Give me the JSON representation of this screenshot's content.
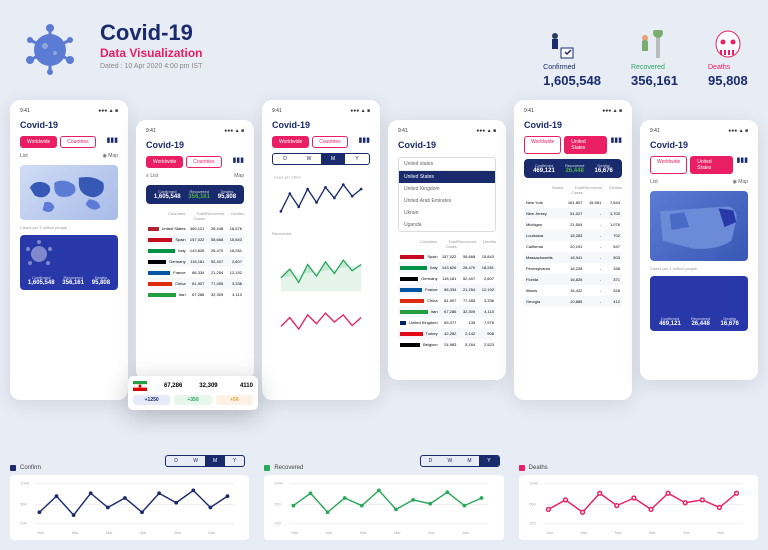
{
  "header": {
    "title": "Covid-19",
    "subtitle": "Data Visualization",
    "dated": "Dated : 10 Apr 2020 4:00 pm IST"
  },
  "top_stats": {
    "confirmed": {
      "label": "Confirmed",
      "value": "1,605,548",
      "color": "#1a2b6d"
    },
    "recovered": {
      "label": "Recovered",
      "value": "356,161",
      "color": "#2aa85c"
    },
    "deaths": {
      "label": "Deaths",
      "value": "95,808",
      "color": "#e91e63"
    }
  },
  "phone_common": {
    "time": "9:41",
    "title": "Covid-19",
    "tab_worldwide": "Worldwide",
    "tab_countries": "Countries",
    "tab_us": "United States",
    "list": "List",
    "map": "Map",
    "cases_per_million": "Cases per 1 million people"
  },
  "stat_bar": {
    "confirmed": {
      "label": "Confirmed",
      "value": "1,605,548"
    },
    "recovered": {
      "label": "Recovered",
      "value": "356,161"
    },
    "deaths": {
      "label": "Deaths",
      "value": "95,808"
    }
  },
  "us_stat_bar": {
    "confirmed": {
      "label": "Confirmed",
      "value": "469,121"
    },
    "recovered": {
      "label": "Recovered",
      "value": "26,448"
    },
    "deaths": {
      "label": "Deaths",
      "value": "16,676"
    }
  },
  "table_headers": {
    "country": "Countries",
    "total": "Total Cases",
    "recovered": "Recovered",
    "deaths": "Deaths"
  },
  "countries": [
    {
      "name": "United States",
      "flag": "#b22234",
      "total": "469,121",
      "recovered": "26,448",
      "deaths": "16,676"
    },
    {
      "name": "Spain",
      "flag": "#c60b1e",
      "total": "157,022",
      "recovered": "55,668",
      "deaths": "15,843"
    },
    {
      "name": "Italy",
      "flag": "#009246",
      "total": "143,626",
      "recovered": "28,470",
      "deaths": "18,281"
    },
    {
      "name": "Germany",
      "flag": "#000",
      "total": "118,181",
      "recovered": "52,407",
      "deaths": "2,607"
    },
    {
      "name": "France",
      "flag": "#0055a4",
      "total": "86,334",
      "recovered": "21,254",
      "deaths": "12,192"
    },
    {
      "name": "China",
      "flag": "#de2910",
      "total": "81,907",
      "recovered": "77,455",
      "deaths": "3,336"
    },
    {
      "name": "Iran",
      "flag": "#239f40",
      "total": "67,286",
      "recovered": "32,309",
      "deaths": "4,110"
    },
    {
      "name": "United Kingdom",
      "flag": "#012169",
      "total": "65,077",
      "recovered": "135",
      "deaths": "7,978"
    },
    {
      "name": "Turkey",
      "flag": "#e30a17",
      "total": "42,282",
      "recovered": "2,142",
      "deaths": "908"
    },
    {
      "name": "Belgium",
      "flag": "#000",
      "total": "24,983",
      "recovered": "5,164",
      "deaths": "2,523"
    }
  ],
  "us_states_header": {
    "state": "States",
    "total": "Total Cases",
    "recovered": "Recovered",
    "deaths": "Deaths"
  },
  "us_states": [
    {
      "name": "New York",
      "total": "161,807",
      "recovered": "15,561",
      "deaths": "7,844"
    },
    {
      "name": "New Jersey",
      "total": "51,027",
      "recovered": "-",
      "deaths": "1,700"
    },
    {
      "name": "Michigan",
      "total": "21,504",
      "recovered": "-",
      "deaths": "1,076"
    },
    {
      "name": "Louisiana",
      "total": "18,283",
      "recovered": "-",
      "deaths": "702"
    },
    {
      "name": "California",
      "total": "20,191",
      "recovered": "-",
      "deaths": "547"
    },
    {
      "name": "Massachusetts",
      "total": "18,941",
      "recovered": "-",
      "deaths": "503"
    },
    {
      "name": "Pennsylvania",
      "total": "18,228",
      "recovered": "-",
      "deaths": "338"
    },
    {
      "name": "Florida",
      "total": "16,826",
      "recovered": "-",
      "deaths": "371"
    },
    {
      "name": "Illinois",
      "total": "16,422",
      "recovered": "-",
      "deaths": "528"
    },
    {
      "name": "Georgia",
      "total": "10,885",
      "recovered": "-",
      "deaths": "412"
    }
  ],
  "dropdown": {
    "input": "United states",
    "selected": "United States",
    "items": [
      "United Kingdom",
      "United Arab Emirates",
      "Ukrain",
      "Uganda"
    ]
  },
  "popup": {
    "total": "67,286",
    "recovered": "32,309",
    "deaths": "4110",
    "delta_total": "+1250",
    "delta_recovered": "+350",
    "delta_deaths": "+56"
  },
  "time_tabs": [
    "D",
    "W",
    "M",
    "Y"
  ],
  "bottom": {
    "confirm": {
      "label": "Confirm",
      "color": "#1a2b6d"
    },
    "recovered": {
      "label": "Recovered",
      "color": "#2aa85c"
    },
    "deaths": {
      "label": "Deaths",
      "color": "#e91e63"
    },
    "y_ticks": [
      "1000",
      "500",
      "200"
    ],
    "x_ticks": [
      "Mar",
      "Mar",
      "Mar",
      "Mar",
      "Mar",
      "Mar",
      "Mar",
      "Mar",
      "Mar",
      "Mar",
      "Mar",
      "Mar"
    ],
    "y_axis": "Cases per million"
  },
  "chart_data": [
    {
      "type": "line",
      "title": "Confirm",
      "ylabel": "Cases per million",
      "ylim": [
        0,
        1000
      ],
      "x": [
        "Mar",
        "Mar",
        "Mar",
        "Mar",
        "Mar",
        "Mar",
        "Mar",
        "Mar",
        "Mar",
        "Mar",
        "Mar",
        "Mar"
      ],
      "values": [
        400,
        650,
        350,
        700,
        450,
        600,
        400,
        700,
        550,
        750,
        500,
        650
      ]
    },
    {
      "type": "line",
      "title": "Recovered",
      "ylabel": "Cases per million",
      "ylim": [
        0,
        1000
      ],
      "x": [
        "Mar",
        "Mar",
        "Mar",
        "Mar",
        "Mar",
        "Mar",
        "Mar",
        "Mar",
        "Mar",
        "Mar",
        "Mar",
        "Mar"
      ],
      "values": [
        500,
        700,
        400,
        650,
        500,
        750,
        450,
        600,
        550,
        700,
        500,
        650
      ]
    },
    {
      "type": "line",
      "title": "Deaths",
      "ylabel": "Cases per million",
      "ylim": [
        0,
        1000
      ],
      "x": [
        "Mar",
        "Mar",
        "Mar",
        "Mar",
        "Mar",
        "Mar",
        "Mar",
        "Mar",
        "Mar",
        "Mar",
        "Mar",
        "Mar"
      ],
      "values": [
        450,
        600,
        400,
        700,
        500,
        650,
        450,
        700,
        550,
        600,
        500,
        700
      ]
    }
  ]
}
